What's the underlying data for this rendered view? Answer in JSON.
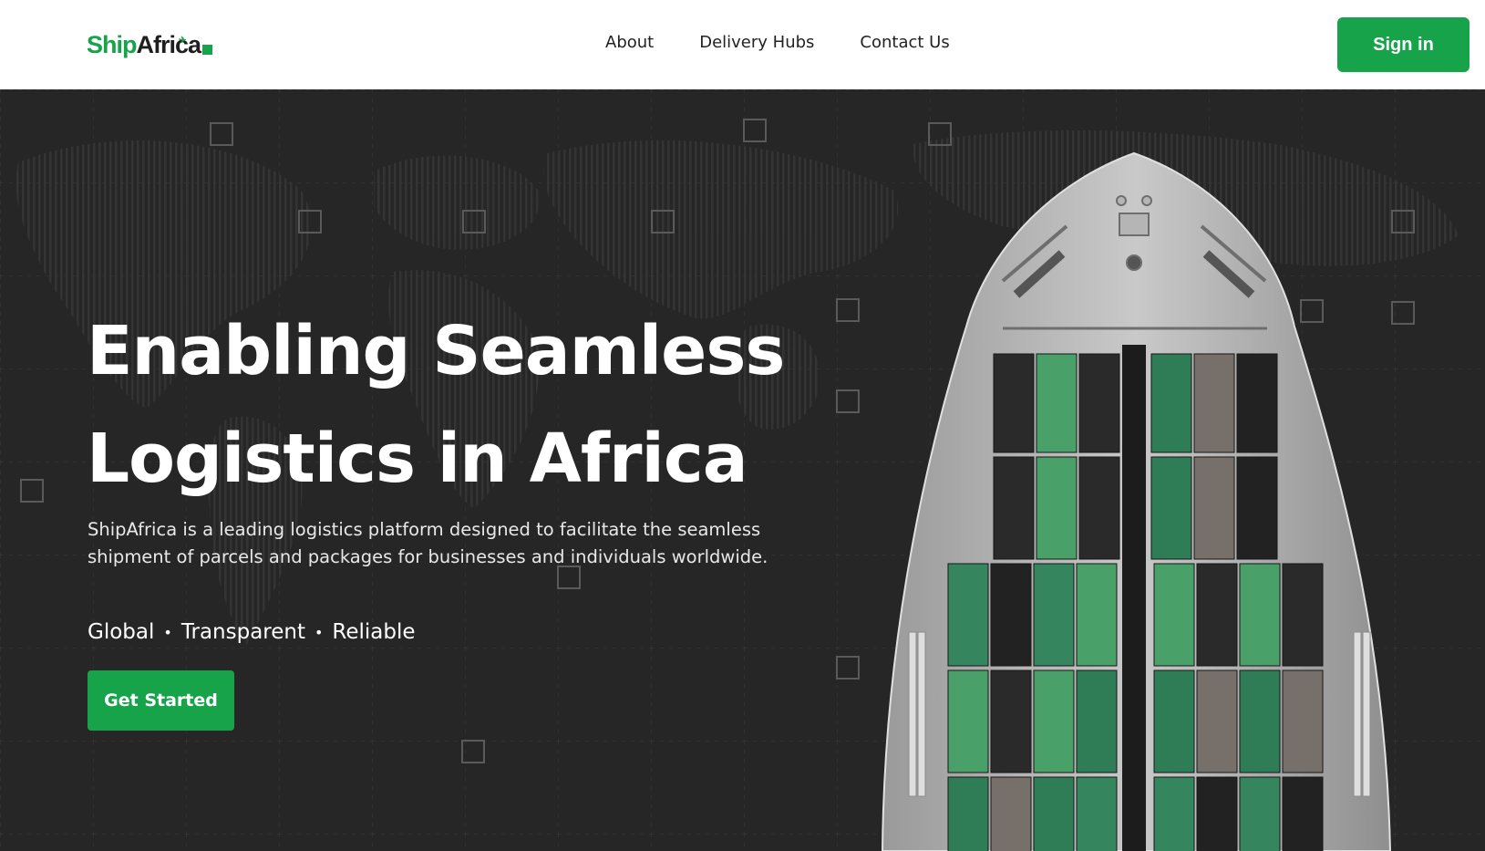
{
  "brand": {
    "name_part1": "Ship",
    "name_part2": "Africa"
  },
  "nav": {
    "links": [
      "About",
      "Delivery Hubs",
      "Contact Us"
    ],
    "signin_label": "Sign in"
  },
  "hero": {
    "headline_line1": "Enabling Seamless",
    "headline_line2": "Logistics in Africa",
    "description": "ShipAfrica is a leading logistics platform designed to facilitate the seamless shipment of parcels and packages for businesses and individuals worldwide.",
    "tagline": [
      "Global",
      "Transparent",
      "Reliable"
    ],
    "cta_label": "Get Started"
  },
  "colors": {
    "accent": "#16a34a",
    "hero_bg": "#262626",
    "nav_bg": "#ffffff"
  },
  "icons": {
    "logo_mark": "plane-icon",
    "logo_box": "box-icon"
  }
}
